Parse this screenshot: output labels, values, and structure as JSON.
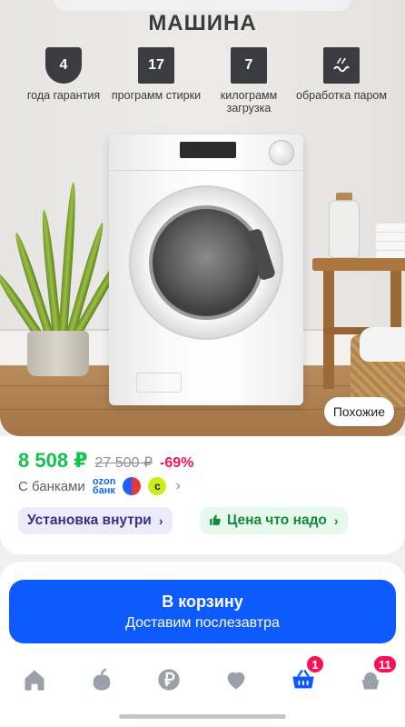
{
  "hero": {
    "title": "МАШИНА",
    "features": [
      {
        "value": "4",
        "label": "года гарантия",
        "icon": "shield-icon"
      },
      {
        "value": "17",
        "label": "программ стирки",
        "icon": "square-icon"
      },
      {
        "value": "7",
        "label": "килограмм загрузка",
        "icon": "square-icon"
      },
      {
        "value": "",
        "label": "обработка паром",
        "icon": "steam-icon"
      }
    ],
    "similar_label": "Похожие"
  },
  "price": {
    "current": "8 508 ₽",
    "old": "27 500 ₽",
    "discount": "-69%",
    "current_color": "#10c44c",
    "discount_color": "#f91155"
  },
  "banks": {
    "label": "С банками",
    "ozon_line1": "ozon",
    "ozon_line2": "банк"
  },
  "chips": {
    "install": "Установка внутри",
    "deal": "Цена что надо"
  },
  "cart": {
    "title": "В корзину",
    "subtitle": "Доставим послезавтра",
    "color": "#0d5bff"
  },
  "tabbar": {
    "items": [
      {
        "icon": "home-icon"
      },
      {
        "icon": "fresh-icon"
      },
      {
        "icon": "ruble-icon"
      },
      {
        "icon": "heart-icon"
      },
      {
        "icon": "cart-icon",
        "badge": "1"
      },
      {
        "icon": "profile-icon",
        "badge": "11"
      }
    ]
  }
}
